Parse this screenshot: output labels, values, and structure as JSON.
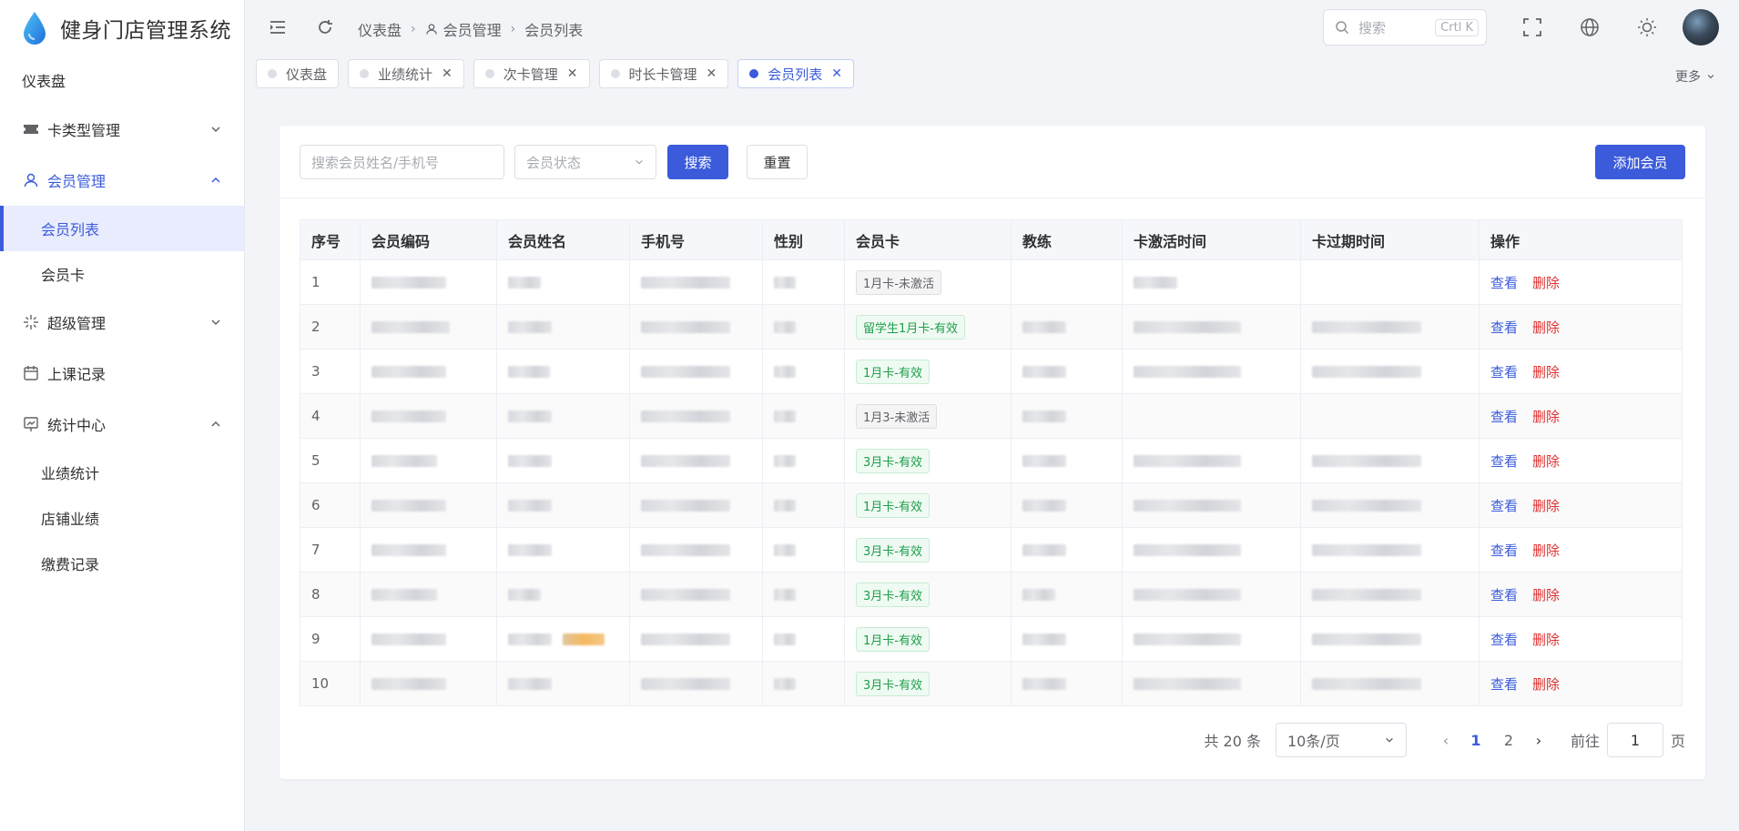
{
  "app": {
    "title": "健身门店管理系统"
  },
  "sidebar": {
    "items": [
      {
        "label": "仪表盘"
      },
      {
        "label": "卡类型管理"
      },
      {
        "label": "会员管理"
      },
      {
        "label": "会员列表"
      },
      {
        "label": "会员卡"
      },
      {
        "label": "超级管理"
      },
      {
        "label": "上课记录"
      },
      {
        "label": "统计中心"
      },
      {
        "label": "业绩统计"
      },
      {
        "label": "店铺业绩"
      },
      {
        "label": "缴费记录"
      }
    ]
  },
  "header": {
    "breadcrumb": [
      "仪表盘",
      "会员管理",
      "会员列表"
    ],
    "search_placeholder": "搜索",
    "shortcut": "Crtl K"
  },
  "tabs": [
    {
      "label": "仪表盘"
    },
    {
      "label": "业绩统计"
    },
    {
      "label": "次卡管理"
    },
    {
      "label": "时长卡管理"
    },
    {
      "label": "会员列表"
    }
  ],
  "more_label": "更多",
  "filters": {
    "search_placeholder": "搜索会员姓名/手机号",
    "status_placeholder": "会员状态",
    "search_button": "搜索",
    "reset_button": "重置",
    "add_button": "添加会员"
  },
  "table": {
    "columns": [
      "序号",
      "会员编码",
      "会员姓名",
      "手机号",
      "性别",
      "会员卡",
      "教练",
      "卡激活时间",
      "卡过期时间",
      "操作"
    ],
    "rows": [
      {
        "index": "1",
        "card": "1月卡-未激活",
        "card_state": "pending"
      },
      {
        "index": "2",
        "card": "留学生1月卡-有效",
        "card_state": "ok"
      },
      {
        "index": "3",
        "card": "1月卡-有效",
        "card_state": "ok"
      },
      {
        "index": "4",
        "card": "1月3-未激活",
        "card_state": "pending"
      },
      {
        "index": "5",
        "card": "3月卡-有效",
        "card_state": "ok"
      },
      {
        "index": "6",
        "card": "1月卡-有效",
        "card_state": "ok"
      },
      {
        "index": "7",
        "card": "3月卡-有效",
        "card_state": "ok"
      },
      {
        "index": "8",
        "card": "3月卡-有效",
        "card_state": "ok"
      },
      {
        "index": "9",
        "card": "1月卡-有效",
        "card_state": "ok"
      },
      {
        "index": "10",
        "card": "3月卡-有效",
        "card_state": "ok"
      }
    ],
    "view_label": "查看",
    "delete_label": "删除"
  },
  "pagination": {
    "total_label": "共 20 条",
    "page_size": "10条/页",
    "pages": [
      "1",
      "2"
    ],
    "current_page": "1",
    "goto_label": "前往",
    "goto_value": "1",
    "page_suffix": "页"
  },
  "colors": {
    "accent": "#3b5bdb",
    "danger": "#e03131",
    "success": "#1f9d4a"
  }
}
